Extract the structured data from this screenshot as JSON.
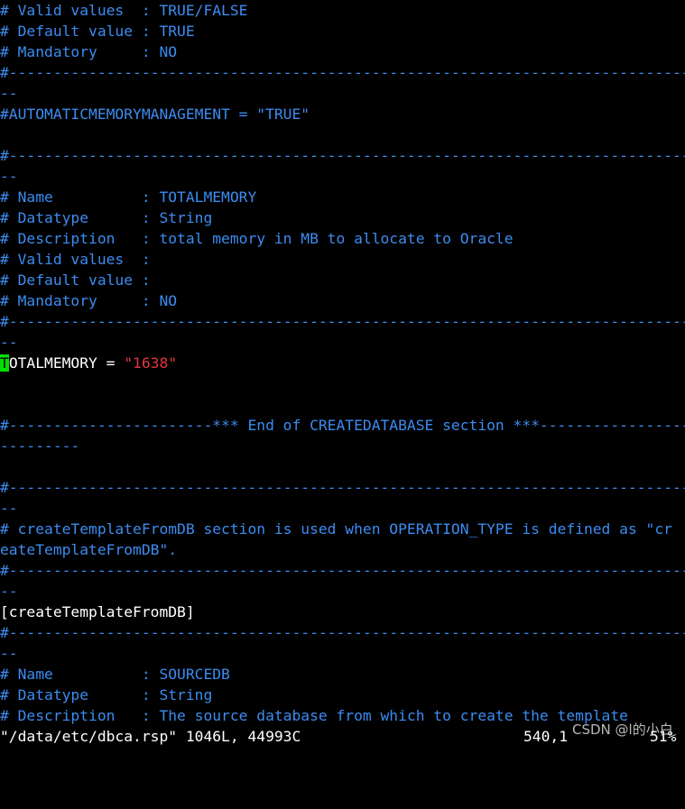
{
  "colors": {
    "background": "#000000",
    "comment": "#3c8cf0",
    "text": "#ffffff",
    "string": "#e0383b",
    "cursor": "#00e000"
  },
  "lines": [
    [
      {
        "t": "# Valid values  : TRUE/FALSE",
        "c": "comment"
      }
    ],
    [
      {
        "t": "# Default value : TRUE",
        "c": "comment"
      }
    ],
    [
      {
        "t": "# Mandatory     : NO",
        "c": "comment"
      }
    ],
    [
      {
        "t": "#-----------------------------------------------------------------------------",
        "c": "comment"
      }
    ],
    [
      {
        "t": "--",
        "c": "comment"
      }
    ],
    [
      {
        "t": "#AUTOMATICMEMORYMANAGEMENT = \"TRUE\"",
        "c": "comment"
      }
    ],
    [
      {
        "t": " ",
        "c": "text"
      }
    ],
    [
      {
        "t": "#-----------------------------------------------------------------------------",
        "c": "comment"
      }
    ],
    [
      {
        "t": "--",
        "c": "comment"
      }
    ],
    [
      {
        "t": "# Name          : TOTALMEMORY",
        "c": "comment"
      }
    ],
    [
      {
        "t": "# Datatype      : String",
        "c": "comment"
      }
    ],
    [
      {
        "t": "# Description   : total memory in MB to allocate to Oracle",
        "c": "comment"
      }
    ],
    [
      {
        "t": "# Valid values  :",
        "c": "comment"
      }
    ],
    [
      {
        "t": "# Default value :",
        "c": "comment"
      }
    ],
    [
      {
        "t": "# Mandatory     : NO",
        "c": "comment"
      }
    ],
    [
      {
        "t": "#-----------------------------------------------------------------------------",
        "c": "comment"
      }
    ],
    [
      {
        "t": "--",
        "c": "comment"
      }
    ],
    [
      {
        "t": "T",
        "c": "cursor"
      },
      {
        "t": "OTALMEMORY = ",
        "c": "text"
      },
      {
        "t": "\"1638\"",
        "c": "string"
      }
    ],
    [
      {
        "t": " ",
        "c": "text"
      }
    ],
    [
      {
        "t": " ",
        "c": "text"
      }
    ],
    [
      {
        "t": "#-----------------------*** End of CREATEDATABASE section ***-----------------",
        "c": "comment"
      }
    ],
    [
      {
        "t": "---------",
        "c": "comment"
      }
    ],
    [
      {
        "t": " ",
        "c": "text"
      }
    ],
    [
      {
        "t": "#-----------------------------------------------------------------------------",
        "c": "comment"
      }
    ],
    [
      {
        "t": "--",
        "c": "comment"
      }
    ],
    [
      {
        "t": "# createTemplateFromDB section is used when OPERATION_TYPE is defined as \"cr",
        "c": "comment"
      }
    ],
    [
      {
        "t": "eateTemplateFromDB\".",
        "c": "comment"
      }
    ],
    [
      {
        "t": "#-----------------------------------------------------------------------------",
        "c": "comment"
      }
    ],
    [
      {
        "t": "--",
        "c": "comment"
      }
    ],
    [
      {
        "t": "[createTemplateFromDB]",
        "c": "text"
      }
    ],
    [
      {
        "t": "#-----------------------------------------------------------------------------",
        "c": "comment"
      }
    ],
    [
      {
        "t": "--",
        "c": "comment"
      }
    ],
    [
      {
        "t": "# Name          : SOURCEDB",
        "c": "comment"
      }
    ],
    [
      {
        "t": "# Datatype      : String",
        "c": "comment"
      }
    ],
    [
      {
        "t": "# Description   : The source database from which to create the template",
        "c": "comment"
      }
    ]
  ],
  "status": {
    "file": "\"/data/etc/dbca.rsp\" 1046L, 44993C",
    "position": "540,1",
    "percent": "51%"
  },
  "watermark": "CSDN @l的小白"
}
